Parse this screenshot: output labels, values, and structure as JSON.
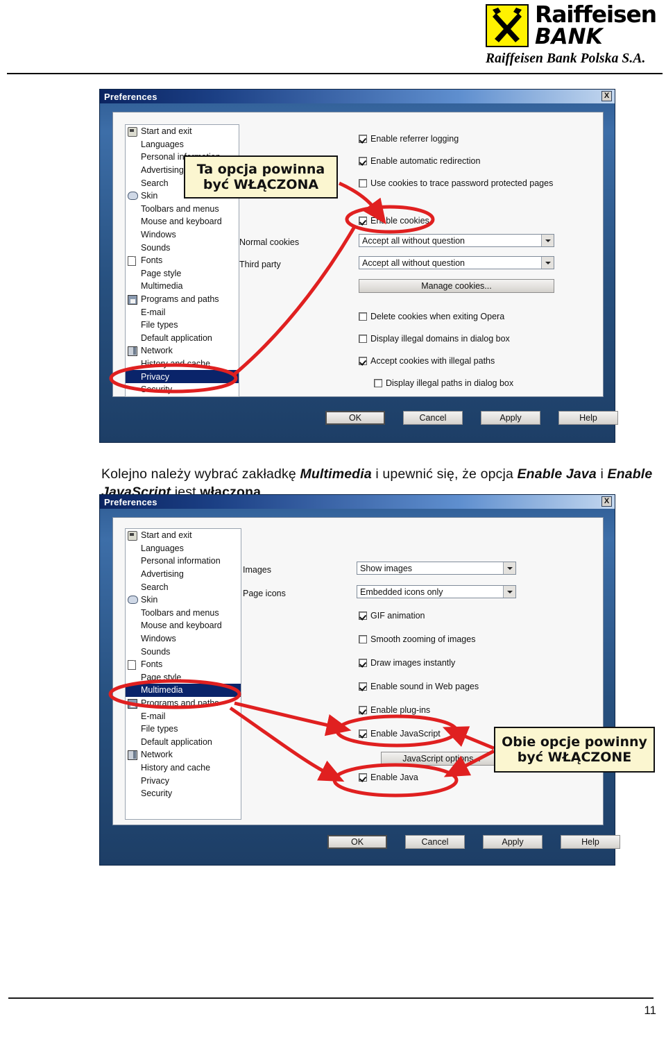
{
  "brand": {
    "name_line1": "Raiffeisen",
    "name_line2": "BANK",
    "subtitle": "Raiffeisen Bank Polska S.A.",
    "logo_bg": "#FFF200"
  },
  "page": {
    "number": "11"
  },
  "instruction": {
    "part1": "Kolejno należy wybrać zakładkę ",
    "em1": "Multimedia",
    "part2": " i upewnić się, że opcja ",
    "em2": "Enable Java",
    "part3": " i ",
    "em3": "Enable JavaScript",
    "part4": " jest ",
    "strong1": "włączona."
  },
  "annotations": {
    "callout1_line1": "Ta opcja powinna",
    "callout1_line2": "być WŁĄCZONA",
    "callout2_line1": "Obie opcje powinny",
    "callout2_line2": "być WŁĄCZONE",
    "color": "#e02020"
  },
  "dialog1": {
    "title": "Preferences",
    "close_label": "X",
    "categories": [
      {
        "label": "Start and exit",
        "icon": "start-icon",
        "selected": false
      },
      {
        "label": "Languages",
        "icon": "none",
        "selected": false
      },
      {
        "label": "Personal information",
        "icon": "none",
        "selected": false
      },
      {
        "label": "Advertising",
        "icon": "none",
        "selected": false
      },
      {
        "label": "Search",
        "icon": "none",
        "selected": false
      },
      {
        "label": "Skin",
        "icon": "skin-icon",
        "selected": false
      },
      {
        "label": "Toolbars and menus",
        "icon": "none",
        "selected": false
      },
      {
        "label": "Mouse and keyboard",
        "icon": "none",
        "selected": false
      },
      {
        "label": "Windows",
        "icon": "none",
        "selected": false
      },
      {
        "label": "Sounds",
        "icon": "none",
        "selected": false
      },
      {
        "label": "Fonts",
        "icon": "font-icon",
        "selected": false
      },
      {
        "label": "Page style",
        "icon": "none",
        "selected": false
      },
      {
        "label": "Multimedia",
        "icon": "none",
        "selected": false
      },
      {
        "label": "Programs and paths",
        "icon": "disk-icon",
        "selected": false
      },
      {
        "label": "E-mail",
        "icon": "none",
        "selected": false
      },
      {
        "label": "File types",
        "icon": "none",
        "selected": false
      },
      {
        "label": "Default application",
        "icon": "none",
        "selected": false
      },
      {
        "label": "Network",
        "icon": "network-icon",
        "selected": false
      },
      {
        "label": "History and cache",
        "icon": "none",
        "selected": false
      },
      {
        "label": "Privacy",
        "icon": "none",
        "selected": true
      },
      {
        "label": "Security",
        "icon": "none",
        "selected": false
      }
    ],
    "checkboxes_top": [
      {
        "label": "Enable referrer logging",
        "checked": true
      },
      {
        "label": "Enable automatic redirection",
        "checked": true
      },
      {
        "label": "Use cookies to trace password protected pages",
        "checked": false
      },
      {
        "label": "Enable cookies",
        "checked": true
      }
    ],
    "normal_cookies_label": "Normal cookies",
    "normal_cookies_value": "Accept all without question",
    "third_party_label": "Third party",
    "third_party_value": "Accept all without question",
    "manage_button": "Manage cookies...",
    "checkboxes_bottom": [
      {
        "label": "Delete cookies when exiting Opera",
        "checked": false
      },
      {
        "label": "Display illegal domains in dialog box",
        "checked": false
      },
      {
        "label": "Accept cookies with illegal paths",
        "checked": true
      },
      {
        "label": "Display illegal paths in dialog box",
        "checked": false
      }
    ],
    "buttons": [
      "OK",
      "Cancel",
      "Apply",
      "Help"
    ]
  },
  "dialog2": {
    "title": "Preferences",
    "close_label": "X",
    "categories": [
      {
        "label": "Start and exit",
        "icon": "start-icon",
        "selected": false
      },
      {
        "label": "Languages",
        "icon": "none",
        "selected": false
      },
      {
        "label": "Personal information",
        "icon": "none",
        "selected": false
      },
      {
        "label": "Advertising",
        "icon": "none",
        "selected": false
      },
      {
        "label": "Search",
        "icon": "none",
        "selected": false
      },
      {
        "label": "Skin",
        "icon": "skin-icon",
        "selected": false
      },
      {
        "label": "Toolbars and menus",
        "icon": "none",
        "selected": false
      },
      {
        "label": "Mouse and keyboard",
        "icon": "none",
        "selected": false
      },
      {
        "label": "Windows",
        "icon": "none",
        "selected": false
      },
      {
        "label": "Sounds",
        "icon": "none",
        "selected": false
      },
      {
        "label": "Fonts",
        "icon": "font-icon",
        "selected": false
      },
      {
        "label": "Page style",
        "icon": "none",
        "selected": false
      },
      {
        "label": "Multimedia",
        "icon": "none",
        "selected": true
      },
      {
        "label": "Programs and paths",
        "icon": "disk-icon",
        "selected": false
      },
      {
        "label": "E-mail",
        "icon": "none",
        "selected": false
      },
      {
        "label": "File types",
        "icon": "none",
        "selected": false
      },
      {
        "label": "Default application",
        "icon": "none",
        "selected": false
      },
      {
        "label": "Network",
        "icon": "network-icon",
        "selected": false
      },
      {
        "label": "History and cache",
        "icon": "none",
        "selected": false
      },
      {
        "label": "Privacy",
        "icon": "none",
        "selected": false
      },
      {
        "label": "Security",
        "icon": "none",
        "selected": false
      }
    ],
    "images_label": "Images",
    "images_value": "Show images",
    "page_icons_label": "Page icons",
    "page_icons_value": "Embedded icons only",
    "checkboxes": [
      {
        "label": "GIF animation",
        "checked": true
      },
      {
        "label": "Smooth zooming of images",
        "checked": false
      },
      {
        "label": "Draw images instantly",
        "checked": true
      },
      {
        "label": "Enable sound in Web pages",
        "checked": true
      },
      {
        "label": "Enable plug-ins",
        "checked": true
      },
      {
        "label": "Enable JavaScript",
        "checked": true
      }
    ],
    "js_options_button": "JavaScript options...",
    "enable_java": {
      "label": "Enable Java",
      "checked": true
    },
    "buttons": [
      "OK",
      "Cancel",
      "Apply",
      "Help"
    ]
  }
}
